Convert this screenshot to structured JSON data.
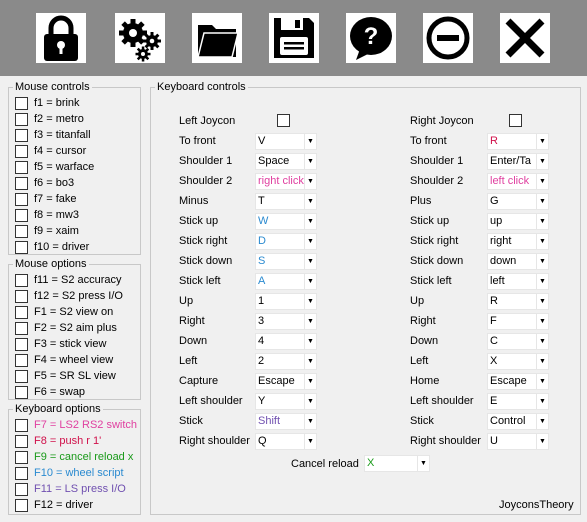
{
  "toolbar": {
    "buttons": [
      {
        "name": "lock-button",
        "icon": "lock-icon"
      },
      {
        "name": "settings-button",
        "icon": "gears-icon"
      },
      {
        "name": "open-folder-button",
        "icon": "folder-icon"
      },
      {
        "name": "save-button",
        "icon": "floppy-disk-icon"
      },
      {
        "name": "help-button",
        "icon": "question-bubble-icon"
      },
      {
        "name": "minimize-button",
        "icon": "minus-circle-icon"
      },
      {
        "name": "close-button",
        "icon": "close-x-icon"
      }
    ]
  },
  "mouse_controls": {
    "title": "Mouse controls",
    "items": [
      {
        "label": "f1 = brink",
        "color": "#000000"
      },
      {
        "label": "f2 = metro",
        "color": "#000000"
      },
      {
        "label": "f3 = titanfall",
        "color": "#000000"
      },
      {
        "label": "f4 = cursor",
        "color": "#000000"
      },
      {
        "label": "f5 = warface",
        "color": "#000000"
      },
      {
        "label": "f6 = bo3",
        "color": "#000000"
      },
      {
        "label": "f7 = fake",
        "color": "#000000"
      },
      {
        "label": "f8 = mw3",
        "color": "#000000"
      },
      {
        "label": "f9 = xaim",
        "color": "#000000"
      },
      {
        "label": "f10 = driver",
        "color": "#000000"
      }
    ]
  },
  "mouse_options": {
    "title": "Mouse options",
    "items": [
      {
        "label": "f11 = S2 accuracy",
        "color": "#000000"
      },
      {
        "label": "f12 = S2 press I/O",
        "color": "#000000"
      },
      {
        "label": "F1 = S2 view on",
        "color": "#000000"
      },
      {
        "label": "F2 = S2 aim plus",
        "color": "#000000"
      },
      {
        "label": "F3 = stick view",
        "color": "#000000"
      },
      {
        "label": "F4 = wheel view",
        "color": "#000000"
      },
      {
        "label": "F5 = SR SL view",
        "color": "#000000"
      },
      {
        "label": "F6 = swap",
        "color": "#000000"
      }
    ]
  },
  "keyboard_options": {
    "title": "Keyboard options",
    "items": [
      {
        "label": "F7 = LS2 RS2 switch",
        "color": "#e040a0"
      },
      {
        "label": "F8 = push r 1'",
        "color": "#d0104a"
      },
      {
        "label": "F9 = cancel reload x",
        "color": "#1a9a1a"
      },
      {
        "label": "F10 = wheel script",
        "color": "#2a8ad0"
      },
      {
        "label": "F11 = LS press I/O",
        "color": "#7050b0"
      },
      {
        "label": "F12 = driver",
        "color": "#000000"
      }
    ]
  },
  "keyboard_controls": {
    "title": "Keyboard controls",
    "left": {
      "header": "Left Joycon",
      "rows": [
        {
          "label": "To front",
          "value": "V",
          "color": "#000000"
        },
        {
          "label": "Shoulder 1",
          "value": "Space",
          "color": "#000000"
        },
        {
          "label": "Shoulder 2",
          "value": "right click",
          "color": "#e040a0"
        },
        {
          "label": "Minus",
          "value": "T",
          "color": "#000000"
        },
        {
          "label": "Stick up",
          "value": "W",
          "color": "#2a8ad0"
        },
        {
          "label": "Stick right",
          "value": "D",
          "color": "#2a8ad0"
        },
        {
          "label": "Stick down",
          "value": "S",
          "color": "#2a8ad0"
        },
        {
          "label": "Stick left",
          "value": "A",
          "color": "#2a8ad0"
        },
        {
          "label": "Up",
          "value": "1",
          "color": "#000000"
        },
        {
          "label": "Right",
          "value": "3",
          "color": "#000000"
        },
        {
          "label": "Down",
          "value": "4",
          "color": "#000000"
        },
        {
          "label": "Left",
          "value": "2",
          "color": "#000000"
        },
        {
          "label": "Capture",
          "value": "Escape",
          "color": "#000000"
        },
        {
          "label": "Left shoulder",
          "value": "Y",
          "color": "#000000"
        },
        {
          "label": "Stick",
          "value": "Shift",
          "color": "#7050b0"
        },
        {
          "label": "Right shoulder",
          "value": "Q",
          "color": "#000000"
        }
      ]
    },
    "right": {
      "header": "Right Joycon",
      "rows": [
        {
          "label": "To front",
          "value": "R",
          "color": "#d0104a"
        },
        {
          "label": "Shoulder 1",
          "value": "Enter/Ta",
          "color": "#000000"
        },
        {
          "label": "Shoulder 2",
          "value": "left click",
          "color": "#e040a0"
        },
        {
          "label": "Plus",
          "value": "G",
          "color": "#000000"
        },
        {
          "label": "Stick up",
          "value": "up",
          "color": "#000000"
        },
        {
          "label": "Stick right",
          "value": "right",
          "color": "#000000"
        },
        {
          "label": "Stick down",
          "value": "down",
          "color": "#000000"
        },
        {
          "label": "Stick left",
          "value": "left",
          "color": "#000000"
        },
        {
          "label": "Up",
          "value": "R",
          "color": "#000000"
        },
        {
          "label": "Right",
          "value": "F",
          "color": "#000000"
        },
        {
          "label": "Down",
          "value": "C",
          "color": "#000000"
        },
        {
          "label": "Left",
          "value": "X",
          "color": "#000000"
        },
        {
          "label": "Home",
          "value": "Escape",
          "color": "#000000"
        },
        {
          "label": "Left shoulder",
          "value": "E",
          "color": "#000000"
        },
        {
          "label": "Stick",
          "value": "Control",
          "color": "#000000"
        },
        {
          "label": "Right shoulder",
          "value": "U",
          "color": "#000000"
        }
      ]
    },
    "cancel_reload": {
      "label": "Cancel reload",
      "value": "X",
      "color": "#1a9a1a"
    },
    "footer": "JoyconsTheory"
  }
}
